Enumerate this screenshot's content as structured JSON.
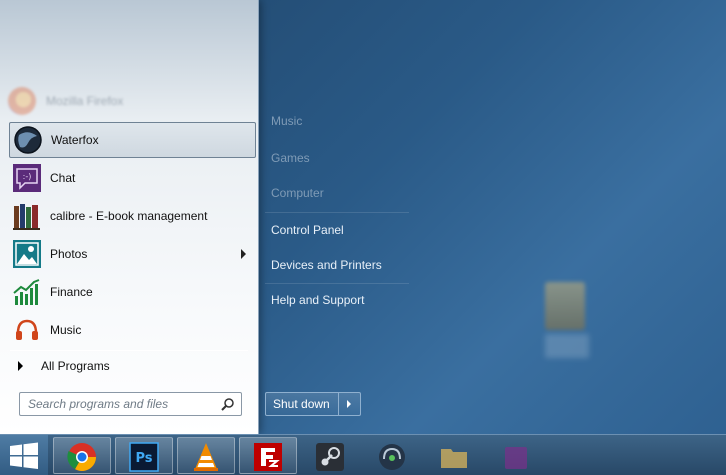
{
  "start_menu": {
    "faded_items": [
      "Mozilla Firefox"
    ],
    "pinned_items": [
      {
        "label": "Waterfox",
        "icon": "waterfox-icon",
        "highlighted": true
      },
      {
        "label": "Chat",
        "icon": "chat-icon"
      },
      {
        "label": "calibre - E-book management",
        "icon": "calibre-icon"
      },
      {
        "label": "Photos",
        "icon": "photos-icon",
        "has_submenu": true
      },
      {
        "label": "Finance",
        "icon": "finance-icon"
      },
      {
        "label": "Music",
        "icon": "music-icon"
      }
    ],
    "all_programs_label": "All Programs",
    "search_placeholder": "Search programs and files",
    "right_items": {
      "music": "Music",
      "games": "Games",
      "computer": "Computer",
      "control_panel": "Control Panel",
      "devices_printers": "Devices and Printers",
      "help_support": "Help and Support"
    },
    "shutdown_label": "Shut down"
  },
  "taskbar": {
    "items": [
      "chrome-icon",
      "photoshop-icon",
      "vlc-icon",
      "filezilla-icon",
      "steam-icon",
      "teamspeak-icon",
      "folder-icon",
      "app-icon"
    ]
  },
  "colors": {
    "accent_blue": "#2a5a87",
    "taskbar": "#2f5475"
  }
}
